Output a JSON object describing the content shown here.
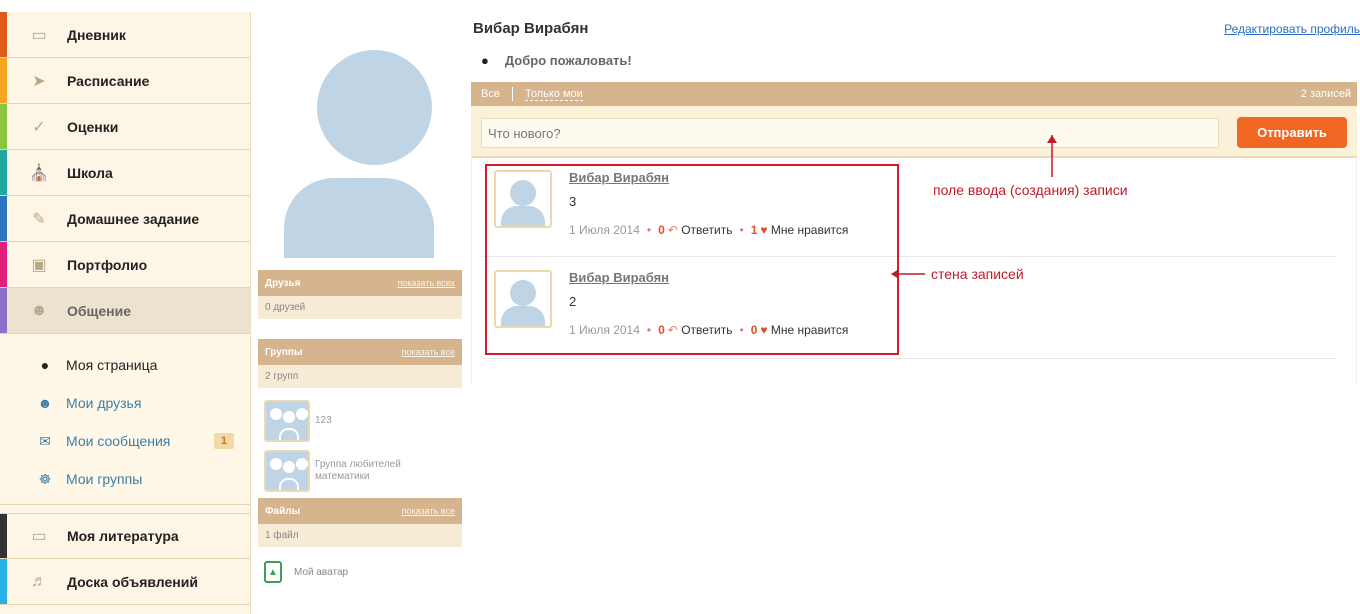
{
  "sidebar": {
    "items": [
      {
        "label": "Дневник",
        "icon": "book-icon",
        "color": "#e05a1a"
      },
      {
        "label": "Расписание",
        "icon": "pin-icon",
        "color": "#f5a623"
      },
      {
        "label": "Оценки",
        "icon": "checkmark-icon",
        "color": "#8cc63f"
      },
      {
        "label": "Школа",
        "icon": "building-icon",
        "color": "#1fa8a0"
      },
      {
        "label": "Домашнее задание",
        "icon": "homework-icon",
        "color": "#2d74c0"
      },
      {
        "label": "Портфолио",
        "icon": "briefcase-icon",
        "color": "#e0207a"
      },
      {
        "label": "Общение",
        "icon": "people-icon",
        "color": "#8e6fc8"
      }
    ],
    "submenu": [
      {
        "label": "Моя страница",
        "icon": "user-icon"
      },
      {
        "label": "Мои друзья",
        "icon": "smile-icon"
      },
      {
        "label": "Мои сообщения",
        "icon": "envelope-icon",
        "badge": "1"
      },
      {
        "label": "Мои группы",
        "icon": "group-icon"
      }
    ],
    "bottom_items": [
      {
        "label": "Моя литература",
        "icon": "book-icon",
        "color": "#333333"
      },
      {
        "label": "Доска объявлений",
        "icon": "megaphone-icon",
        "color": "#2ab0e8"
      }
    ]
  },
  "midcol": {
    "friends": {
      "title": "Друзья",
      "link": "показать всех",
      "count": "0 друзей"
    },
    "groups": {
      "title": "Группы",
      "link": "показать все",
      "count": "2 групп",
      "list": [
        {
          "name": "123"
        },
        {
          "name": "Группа любителей математики"
        }
      ]
    },
    "files": {
      "title": "Файлы",
      "link": "показать все",
      "count": "1 файл",
      "file_name": "Мой аватар"
    }
  },
  "main": {
    "profile_name": "Вибар Вирабян",
    "edit_link": "Редактировать профиль",
    "welcome": "Добро пожаловать!",
    "filter_all": "Все",
    "filter_mine": "Только мои",
    "records_count": "2 записей",
    "compose_placeholder": "Что нового?",
    "send_label": "Отправить",
    "posts": [
      {
        "author": "Вибар Вирабян",
        "text": "3",
        "date": "1 Июля 2014",
        "replies": "0",
        "reply_label": "Ответить",
        "likes": "1",
        "like_label": "Мне нравится"
      },
      {
        "author": "Вибар Вирабян",
        "text": "2",
        "date": "1 Июля 2014",
        "replies": "0",
        "reply_label": "Ответить",
        "likes": "0",
        "like_label": "Мне нравится"
      }
    ]
  },
  "annotations": {
    "input_note": "поле ввода (создания) записи",
    "wall_note": "стена записей",
    "color": "#c01b2b"
  },
  "colors": {
    "accent": "#f06724",
    "panel": "#d6b48d",
    "sidebar_bg": "#fdf6e6",
    "link": "#2a6fc0"
  }
}
